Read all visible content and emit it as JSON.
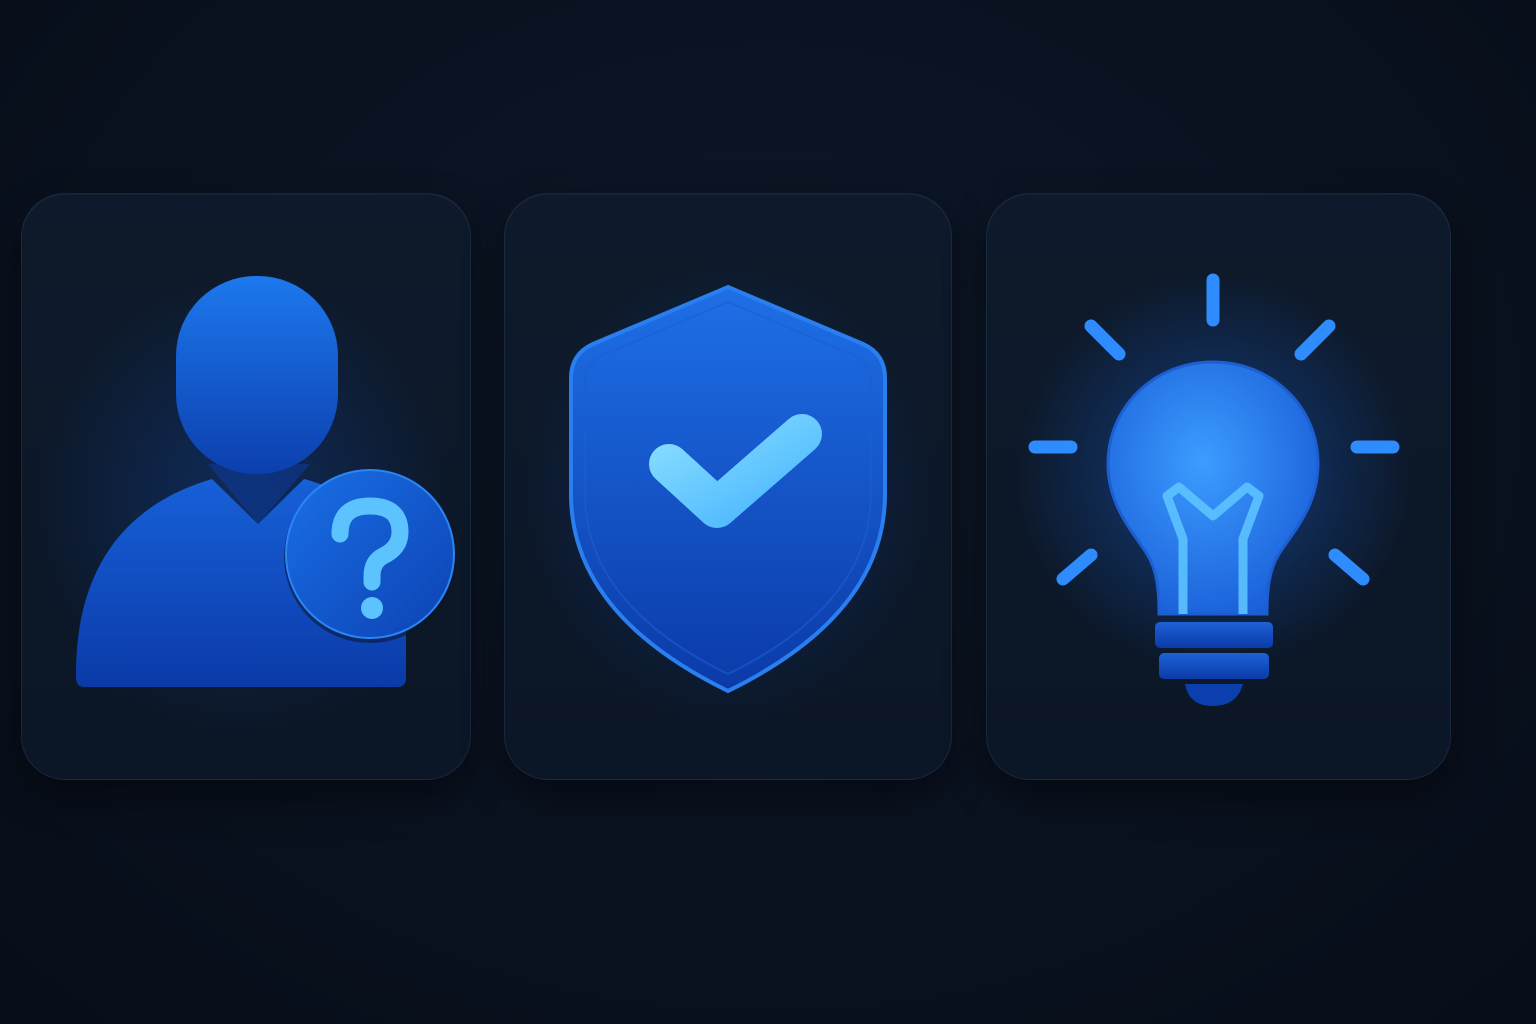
{
  "cards": [
    {
      "icon": "user-question-icon",
      "badge_glyph": "?"
    },
    {
      "icon": "shield-check-icon"
    },
    {
      "icon": "lightbulb-icon"
    }
  ],
  "colors": {
    "background": "#0a1220",
    "card": "#0d1828",
    "icon_blue": "#1f63d8",
    "icon_light": "#5ec8ff",
    "icon_deep": "#0b3aa8"
  }
}
